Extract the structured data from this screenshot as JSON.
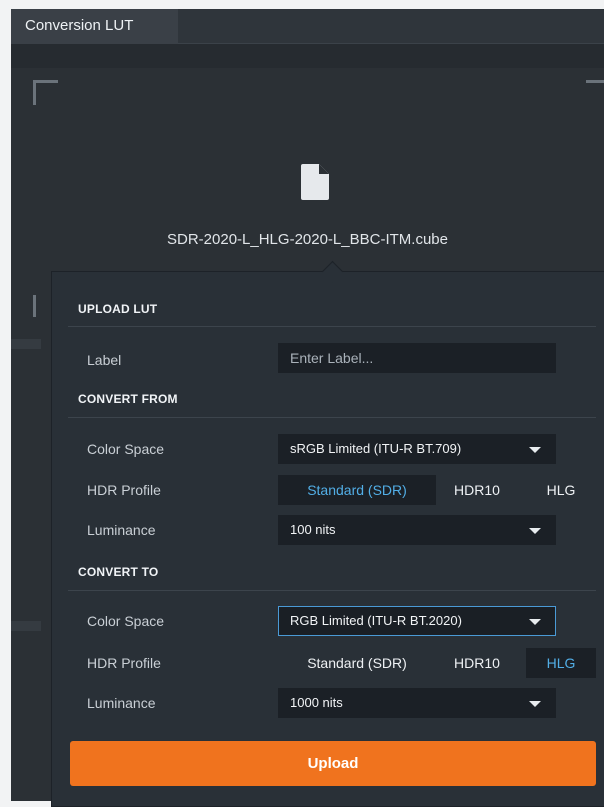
{
  "tabs": [
    {
      "label": "Conversion LUT"
    }
  ],
  "dropzone": {
    "file_icon": "file-icon",
    "file_name": "SDR-2020-L_HLG-2020-L_BBC-ITM.cube"
  },
  "upload_lut": {
    "title": "UPLOAD LUT",
    "label_field": {
      "label": "Label",
      "value": "",
      "placeholder": "Enter Label..."
    }
  },
  "convert_from": {
    "title": "CONVERT FROM",
    "color_space": {
      "label": "Color Space",
      "value": "sRGB Limited (ITU-R BT.709)"
    },
    "hdr_profile": {
      "label": "HDR Profile",
      "options": [
        "Standard (SDR)",
        "HDR10",
        "HLG"
      ],
      "selected": "Standard (SDR)"
    },
    "luminance": {
      "label": "Luminance",
      "value": "100 nits"
    }
  },
  "convert_to": {
    "title": "CONVERT TO",
    "color_space": {
      "label": "Color Space",
      "value": "RGB Limited (ITU-R BT.2020)"
    },
    "hdr_profile": {
      "label": "HDR Profile",
      "options": [
        "Standard (SDR)",
        "HDR10",
        "HLG"
      ],
      "selected": "HLG"
    },
    "luminance": {
      "label": "Luminance",
      "value": "1000 nits"
    }
  },
  "upload_button": {
    "label": "Upload"
  },
  "colors": {
    "accent": "#f0731e",
    "selected_text": "#52aee6",
    "focus_border": "#4a9ad6",
    "panel_bg": "#293037"
  }
}
